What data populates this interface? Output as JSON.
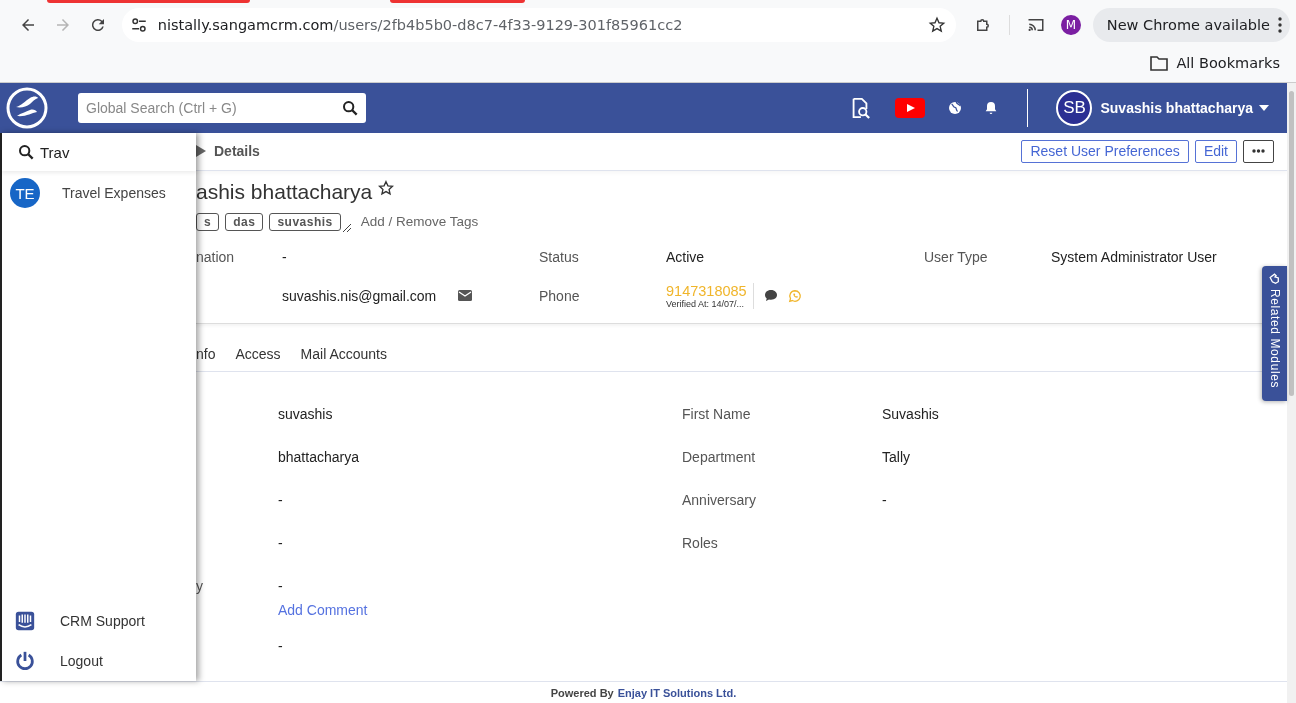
{
  "browser": {
    "url_host": "nistally.sangamcrm.com",
    "url_path": "/users/2fb4b5b0-d8c7-4f33-9129-301f85961cc2",
    "forward_disabled": true,
    "profile_initial": "M",
    "update_label": "New Chrome available",
    "bookmarks_label": "All Bookmarks"
  },
  "header": {
    "search_placeholder": "Global Search (Ctrl + G)",
    "user_initials": "SB",
    "user_name": "Suvashis bhattacharya"
  },
  "drawer": {
    "search_value": "Trav",
    "results": [
      {
        "initials": "TE",
        "label": "Travel Expenses"
      }
    ],
    "footer_items": [
      {
        "kind": "support",
        "label": "CRM Support"
      },
      {
        "kind": "logout",
        "label": "Logout"
      }
    ]
  },
  "breadcrumb": {
    "current": "Details"
  },
  "actions": [
    "Reset User Preferences",
    "Edit"
  ],
  "record": {
    "title": "ashis bhattacharya",
    "favorite": false,
    "tags": [
      "s",
      "das",
      "suvashis"
    ],
    "tags_action": "Add / Remove Tags",
    "summary": [
      [
        {
          "label": "nation",
          "value": "-"
        },
        {
          "label": "Status",
          "value": "Active"
        },
        {
          "label": "User Type",
          "value": "System Administrator User"
        }
      ],
      [
        {
          "kind": "email",
          "value": "suvashis.nis@gmail.com"
        },
        {
          "kind": "phone",
          "label": "Phone",
          "value": "9147318085",
          "note": "Verified At: 14/07/..."
        }
      ]
    ],
    "tabs": [
      {
        "label": "nfo",
        "selected": false
      },
      {
        "label": "Access",
        "selected": false
      },
      {
        "label": "Mail Accounts",
        "selected": false
      }
    ],
    "details_left": [
      {
        "value": "suvashis"
      },
      {
        "value": "bhattacharya"
      },
      {
        "value": "-"
      },
      {
        "value": "-"
      },
      {
        "label": "y",
        "value": "-",
        "link": "Add Comment"
      },
      {
        "value": "-"
      }
    ],
    "details_right": [
      {
        "label": "First Name",
        "value": "Suvashis"
      },
      {
        "label": "Department",
        "value": "Tally"
      },
      {
        "label": "Anniversary",
        "value": "-"
      },
      {
        "label": "Roles"
      }
    ]
  },
  "related_tab": "Related Modules",
  "footer": {
    "prefix": "Powered By",
    "company": "Enjay IT Solutions Ltd."
  }
}
